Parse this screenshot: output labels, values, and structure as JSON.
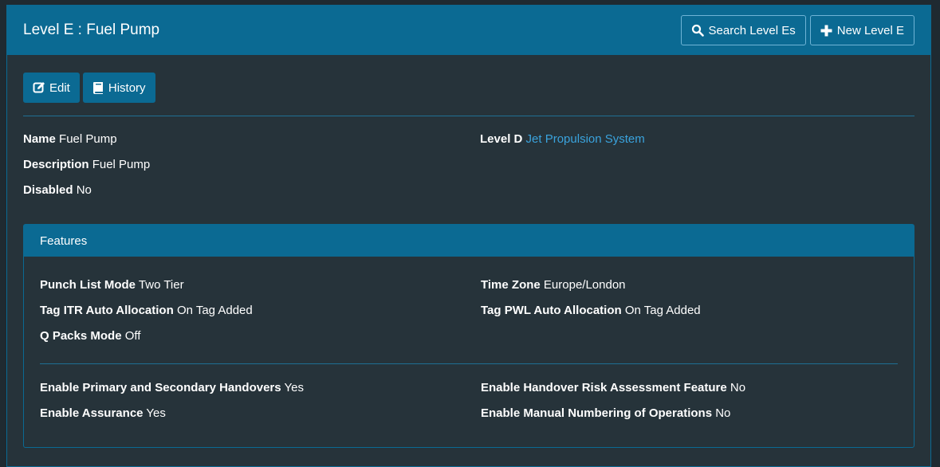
{
  "header": {
    "title": "Level E : Fuel Pump",
    "search_label": "Search Level Es",
    "new_label": "New Level E",
    "icons": [
      "search-icon",
      "plus-icon"
    ]
  },
  "actions": {
    "edit_label": "Edit",
    "history_label": "History",
    "icons": [
      "edit-icon",
      "book-icon"
    ]
  },
  "details": {
    "name": {
      "label": "Name",
      "value": "Fuel Pump"
    },
    "level_d": {
      "label": "Level D",
      "value": "Jet Propulsion System"
    },
    "description": {
      "label": "Description",
      "value": "Fuel Pump"
    },
    "disabled": {
      "label": "Disabled",
      "value": "No"
    }
  },
  "features": {
    "title": "Features",
    "punch_list_mode": {
      "label": "Punch List Mode",
      "value": "Two Tier"
    },
    "time_zone": {
      "label": "Time Zone",
      "value": "Europe/London"
    },
    "tag_itr": {
      "label": "Tag ITR Auto Allocation",
      "value": "On Tag Added"
    },
    "tag_pwl": {
      "label": "Tag PWL Auto Allocation",
      "value": "On Tag Added"
    },
    "q_packs": {
      "label": "Q Packs Mode",
      "value": "Off"
    },
    "handovers": {
      "label": "Enable Primary and Secondary Handovers",
      "value": "Yes"
    },
    "risk": {
      "label": "Enable Handover Risk Assessment Feature",
      "value": "No"
    },
    "assurance": {
      "label": "Enable Assurance",
      "value": "Yes"
    },
    "manual_numbering": {
      "label": "Enable Manual Numbering of Operations",
      "value": "No"
    }
  },
  "colors": {
    "page_bg": "#26333a",
    "accent": "#0b6a93",
    "link": "#3aa3dd"
  }
}
